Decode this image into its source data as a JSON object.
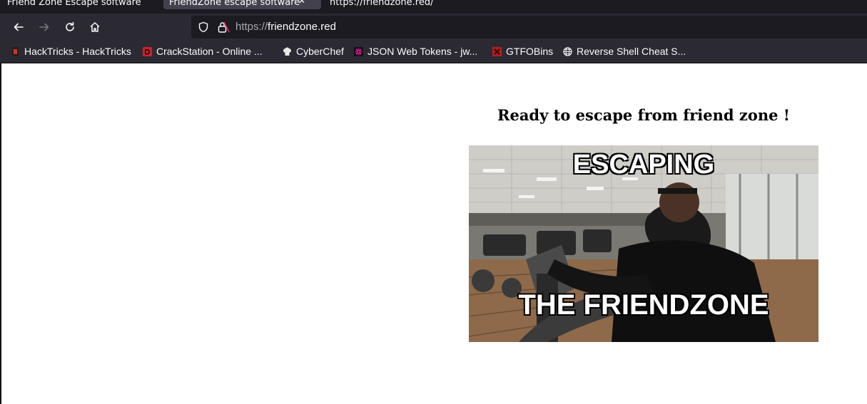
{
  "browser": {
    "tabs": [
      {
        "label": "Friend Zone Escape software"
      },
      {
        "label": "FriendZone escape software"
      },
      {
        "label": "https://friendzone.red/"
      }
    ],
    "url": {
      "scheme": "https://",
      "host": "friendzone.red"
    },
    "bookmarks": [
      {
        "label": "HackTricks - HackTricks",
        "icon": "hacktricks-icon",
        "color": "#c0392b"
      },
      {
        "label": "CrackStation - Online ...",
        "icon": "crackstation-icon",
        "color": "#d01f2e"
      },
      {
        "label": "CyberChef",
        "icon": "chef-hat-icon",
        "color": "#e8e8e8"
      },
      {
        "label": "JSON Web Tokens - jw...",
        "icon": "jwt-icon",
        "color": "#d63aff"
      },
      {
        "label": "GTFOBins",
        "icon": "gtfobins-icon",
        "color": "#b71c1c"
      },
      {
        "label": "Reverse Shell Cheat S...",
        "icon": "globe-icon",
        "color": "#fbfbfe"
      }
    ]
  },
  "page": {
    "headline": "Ready to escape from friend zone !",
    "meme": {
      "top_text": "ESCAPING",
      "bottom_text": "THE FRIENDZONE"
    }
  }
}
